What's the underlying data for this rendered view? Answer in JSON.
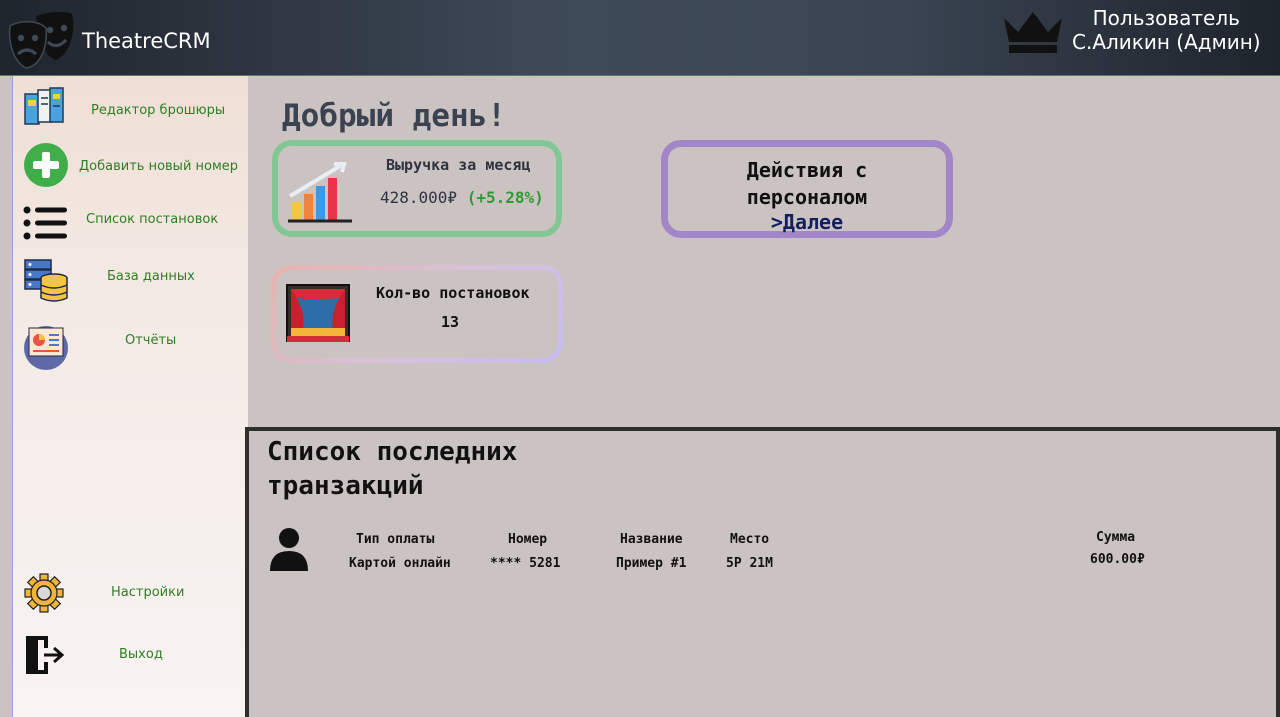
{
  "header": {
    "app_title": "TheatreCRM",
    "user_line1": "Пользователь",
    "user_line2": "С.Аликин (Админ)",
    "logo_icon": "theatre-masks-icon",
    "role_icon": "crown-icon"
  },
  "sidebar": {
    "items": [
      {
        "label": "Редактор брошюры",
        "icon": "brochure-icon"
      },
      {
        "label": "Добавить новый номер",
        "icon": "plus-circle-icon"
      },
      {
        "label": "Список постановок",
        "icon": "list-icon"
      },
      {
        "label": "База данных",
        "icon": "database-icon"
      },
      {
        "label": "Отчёты",
        "icon": "report-icon"
      }
    ],
    "bottom_items": [
      {
        "label": "Настройки",
        "icon": "gear-icon"
      },
      {
        "label": "Выход",
        "icon": "logout-icon"
      }
    ]
  },
  "main": {
    "greeting": "Добрый день!",
    "revenue_card": {
      "title": "Выручка за месяц",
      "value": "428.000₽",
      "delta": "(+5.28%)",
      "icon": "bar-chart-icon"
    },
    "staff_card": {
      "title_line1": "Действия с",
      "title_line2": "персоналом",
      "link": ">Далее"
    },
    "shows_card": {
      "title": "Кол-во постановок",
      "value": "13",
      "icon": "theatre-stage-icon"
    }
  },
  "transactions": {
    "title_line1": "Список последних",
    "title_line2": "транзакций",
    "columns": {
      "payment_type": "Тип оплаты",
      "number": "Номер",
      "name": "Название",
      "seat": "Место",
      "sum": "Сумма"
    },
    "rows": [
      {
        "payment_type": "Картой онлайн",
        "number": "**** 5281",
        "name": "Пример #1",
        "seat": "5Р 21М",
        "sum": "600.00₽",
        "icon": "user-icon"
      }
    ]
  },
  "colors": {
    "accent_green": "#2f7d25",
    "revenue_border": "#82c793",
    "staff_border": "#a386c7",
    "delta_green": "#2e9a34",
    "link_navy": "#12205e"
  }
}
